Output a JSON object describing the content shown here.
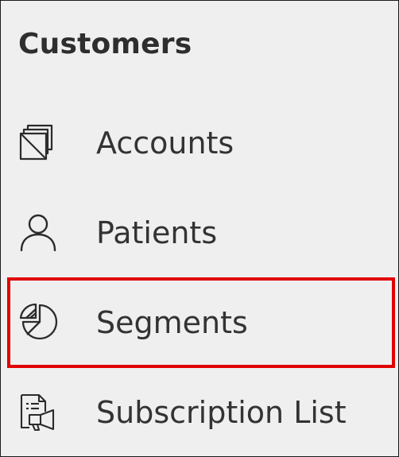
{
  "section": {
    "title": "Customers"
  },
  "nav": {
    "items": [
      {
        "label": "Accounts",
        "icon": "accounts-icon"
      },
      {
        "label": "Patients",
        "icon": "person-icon"
      },
      {
        "label": "Segments",
        "icon": "pie-chart-icon",
        "highlighted": true
      },
      {
        "label": "Subscription List",
        "icon": "subscription-list-icon"
      }
    ]
  },
  "colors": {
    "background": "#efefef",
    "text": "#333333",
    "highlight": "#e00000",
    "border": "#1a1a1a"
  }
}
